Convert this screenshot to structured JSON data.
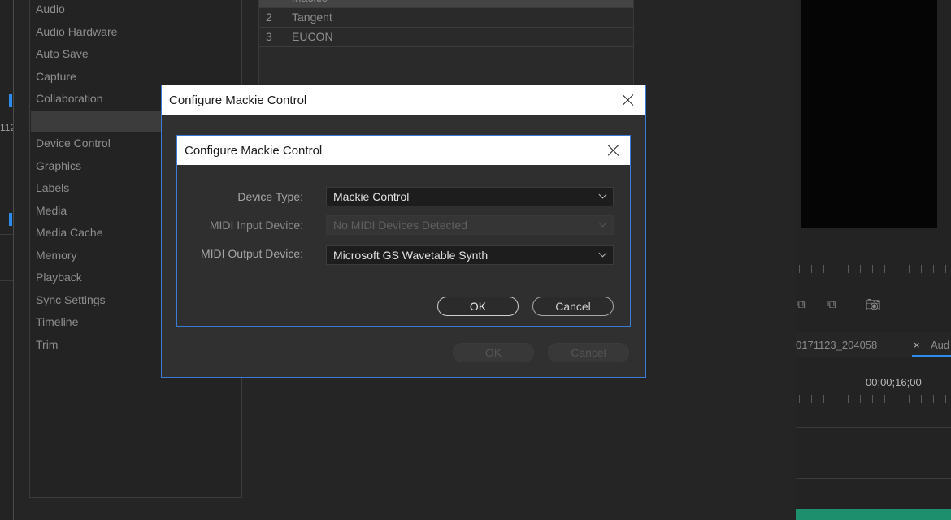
{
  "background": {
    "left_strip_label": "112",
    "sidebar_items": [
      "Audio",
      "Audio Hardware",
      "Auto Save",
      "Capture",
      "Collaboration",
      "",
      "Device Control",
      "Graphics",
      "Labels",
      "Media",
      "Media Cache",
      "Memory",
      "Playback",
      "Sync Settings",
      "Timeline",
      "Trim"
    ],
    "device_table": [
      {
        "num": "",
        "name": "Mackie"
      },
      {
        "num": "2",
        "name": "Tangent"
      },
      {
        "num": "3",
        "name": "EUCON"
      }
    ],
    "right_panel": {
      "sequence_tab": "0171123_204058",
      "close_glyph": "×",
      "audio_tab": "Aud",
      "timecode": "00;00;16;00",
      "icons": [
        "insert-icon",
        "overwrite-icon",
        "export-frame-icon"
      ]
    }
  },
  "outer_dialog": {
    "title": "Configure Mackie Control",
    "ok_label": "OK",
    "cancel_label": "Cancel"
  },
  "inner_dialog": {
    "title": "Configure Mackie Control",
    "fields": [
      {
        "label": "Device Type:",
        "value": "Mackie Control",
        "enabled": true
      },
      {
        "label": "MIDI Input Device:",
        "value": "No MIDI Devices Detected",
        "enabled": false
      },
      {
        "label": "MIDI Output Device:",
        "value": "Microsoft GS Wavetable Synth",
        "enabled": true
      }
    ],
    "ok_label": "OK",
    "cancel_label": "Cancel"
  },
  "colors": {
    "accent": "#2d8ceb",
    "dialog_border": "#3a7bd5",
    "timeline_bar": "#1e8f6c"
  }
}
